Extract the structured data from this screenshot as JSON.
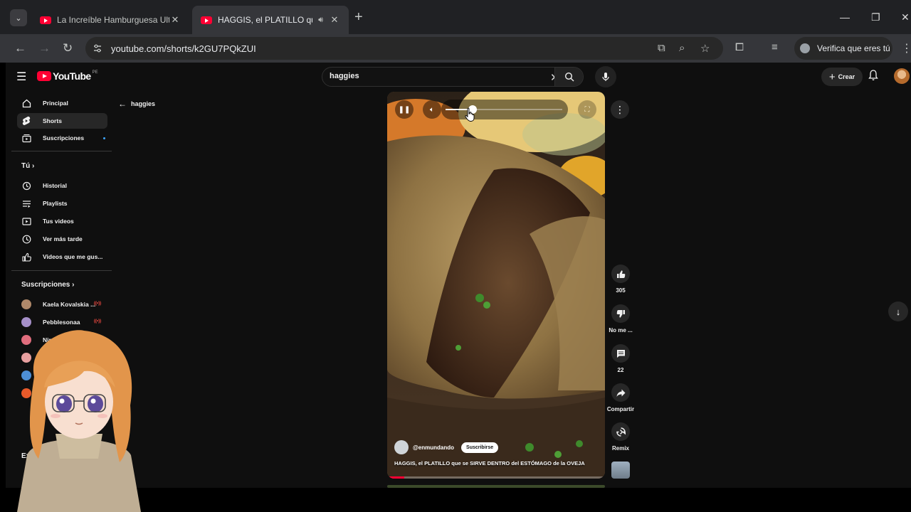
{
  "browser": {
    "tabs": [
      {
        "title": "La Increíble Hamburguesa Ultim",
        "active": false
      },
      {
        "title": "HAGGIS, el PLATILLO que se",
        "active": true
      }
    ],
    "url": "youtube.com/shorts/k2GU7PQkZUI",
    "verify_label": "Verifica que eres tú"
  },
  "youtube": {
    "logo_text": "YouTube",
    "region": "PE",
    "search": {
      "query": "haggies"
    },
    "create_label": "Crear",
    "back_label": "haggies"
  },
  "sidebar": {
    "main": [
      {
        "label": "Principal",
        "icon": "home-icon"
      },
      {
        "label": "Shorts",
        "icon": "shorts-icon",
        "active": true
      },
      {
        "label": "Suscripciones",
        "icon": "subscriptions-icon"
      }
    ],
    "you_header": "Tú",
    "you": [
      {
        "label": "Historial",
        "icon": "history-icon"
      },
      {
        "label": "Playlists",
        "icon": "playlist-icon"
      },
      {
        "label": "Tus videos",
        "icon": "your-videos-icon"
      },
      {
        "label": "Ver más tarde",
        "icon": "watch-later-icon"
      },
      {
        "label": "Videos que me gus...",
        "icon": "liked-icon"
      }
    ],
    "subs_header": "Suscripciones",
    "subs": [
      {
        "label": "Kaela Kovalskia ...",
        "color": "#b0896a"
      },
      {
        "label": "Pebblesonaa",
        "color": "#a58fc8"
      },
      {
        "label": "Nim",
        "color": "#e06d7d"
      }
    ],
    "explore_header": "Explorar"
  },
  "short": {
    "volume_level": 0.23,
    "progress": 0.08,
    "channel": "@enmundando",
    "subscribe_label": "Suscribirse",
    "title": "HAGGIS, el PLATILLO que se SIRVE DENTRO del ESTÓMAGO de la OVEJA"
  },
  "actions": {
    "likes": "305",
    "dislike_label": "No me ...",
    "comments": "22",
    "share_label": "Compartir",
    "remix_label": "Remix"
  },
  "colors": {
    "youtube_red": "#ff0033",
    "page_bg": "#0f0f0f",
    "accent_blue": "#3ea6ff"
  }
}
